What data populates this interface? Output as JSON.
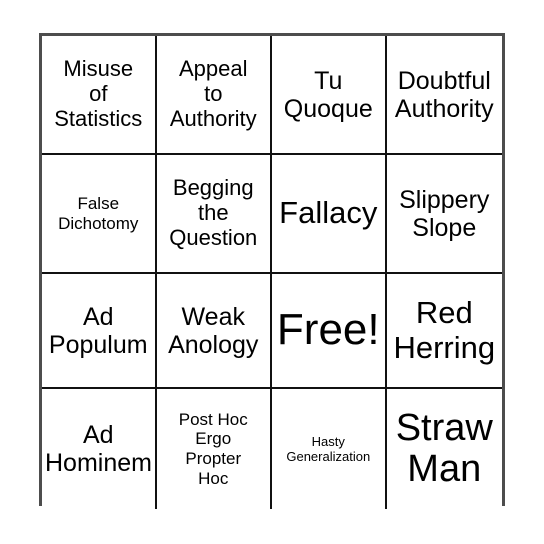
{
  "card": {
    "type": "bingo-card",
    "columns": 4,
    "rows": 4,
    "background_color": "#ffffff",
    "text_color": "#000000",
    "outer_border_color": "#4d4d4d",
    "inner_border_color": "#111111",
    "free_space": {
      "row": 3,
      "column": 3,
      "label": "Free!"
    },
    "cells": [
      [
        {
          "label": "Misuse\nof\nStatistics",
          "size": "md"
        },
        {
          "label": "Appeal\nto\nAuthority",
          "size": "md"
        },
        {
          "label": "Tu\nQuoque",
          "size": "lg"
        },
        {
          "label": "Doubtful\nAuthority",
          "size": "lg"
        }
      ],
      [
        {
          "label": "False\nDichotomy",
          "size": "sm"
        },
        {
          "label": "Begging\nthe\nQuestion",
          "size": "md"
        },
        {
          "label": "Fallacy",
          "size": "xl"
        },
        {
          "label": "Slippery\nSlope",
          "size": "lg"
        }
      ],
      [
        {
          "label": "Ad\nPopulum",
          "size": "lg"
        },
        {
          "label": "Weak\nAnology",
          "size": "lg"
        },
        {
          "label": "Free!",
          "size": "huge"
        },
        {
          "label": "Red\nHerring",
          "size": "xl"
        }
      ],
      [
        {
          "label": "Ad\nHominem",
          "size": "lg"
        },
        {
          "label": "Post Hoc\nErgo\nPropter\nHoc",
          "size": "sm"
        },
        {
          "label": "Hasty\nGeneralization",
          "size": "xs"
        },
        {
          "label": "Straw\nMan",
          "size": "xxl"
        }
      ]
    ]
  }
}
